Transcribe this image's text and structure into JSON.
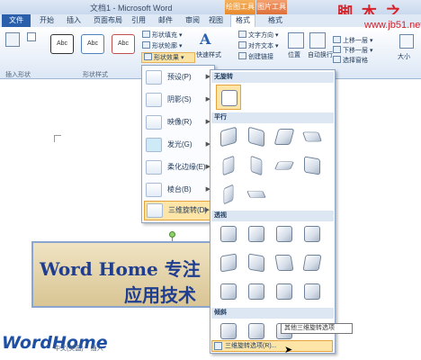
{
  "window": {
    "title": "文档1 - Microsoft Word"
  },
  "context_tabs": {
    "drawing": "绘图工具",
    "picture": "图片工具"
  },
  "watermark": {
    "text": "脚 本 之 家",
    "url": "www.jb51.net"
  },
  "tabs": {
    "file": "文件",
    "home": "开始",
    "insert": "插入",
    "layout": "页面布局",
    "references": "引用",
    "mailings": "邮件",
    "review": "审阅",
    "view": "视图",
    "format": "格式",
    "format2": "格式"
  },
  "ribbon": {
    "insert_shapes": "插入形状",
    "shape_styles": "形状样式",
    "style1": "Abc",
    "style2": "Abc",
    "style3": "Abc",
    "fill": "形状填充 ▾",
    "outline": "形状轮廓 ▾",
    "effects": "形状效果 ▾",
    "quick_styles": "快速样式",
    "text_direction": "文字方向 ▾",
    "align_text": "对齐文本 ▾",
    "create_link": "创建链接",
    "position": "位置",
    "wrap": "自动换行",
    "bring_forward": "上移一层 ▾",
    "send_backward": "下移一层 ▾",
    "selection_pane": "选择窗格",
    "size": "大小"
  },
  "menu1": {
    "items": [
      {
        "label": "预设(P)"
      },
      {
        "label": "阴影(S)"
      },
      {
        "label": "映像(R)"
      },
      {
        "label": "发光(G)"
      },
      {
        "label": "柔化边缘(E)"
      },
      {
        "label": "棱台(B)"
      },
      {
        "label": "三维旋转(D)"
      }
    ]
  },
  "menu2": {
    "sections": {
      "none": "无旋转",
      "parallel": "平行",
      "perspective": "透视",
      "oblique": "倾斜"
    },
    "footer": "三维旋转选项(R)...",
    "tooltip": "其他三维旋转选项"
  },
  "document": {
    "line1": "Word Home 专注",
    "line2": "应用技术"
  },
  "logo": "WordHome",
  "status": {
    "lang": "中文(美国)",
    "mode": "插入"
  }
}
